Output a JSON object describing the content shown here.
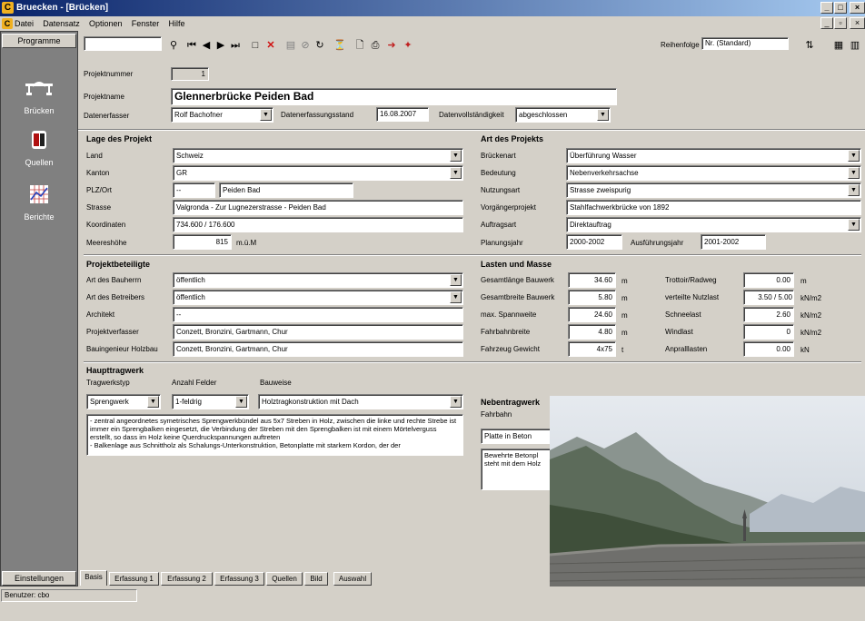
{
  "window": {
    "title": "Bruecken - [Brücken]",
    "app_letter": "C"
  },
  "menu": {
    "items": [
      "Datei",
      "Datensatz",
      "Optionen",
      "Fenster",
      "Hilfe"
    ]
  },
  "sidebar": {
    "header": "Programme",
    "items": [
      {
        "label": "Brücken",
        "icon": "bridge-icon"
      },
      {
        "label": "Quellen",
        "icon": "books-icon"
      },
      {
        "label": "Berichte",
        "icon": "report-chart-icon"
      }
    ],
    "footer": "Einstellungen"
  },
  "toolbar": {
    "search_value": "",
    "sort_label": "Reihenfolge",
    "sort_value": "Nr. (Standard)"
  },
  "project": {
    "number_label": "Projektnummer",
    "number": "1",
    "name_label": "Projektname",
    "name": "Glennerbrücke Peiden Bad",
    "author_label": "Datenerfasser",
    "author": "Rolf Bachofner",
    "date_label": "Datenerfassungsstand",
    "date": "16.08.2007",
    "completeness_label": "Datenvollständigkeit",
    "completeness": "abgeschlossen"
  },
  "lage": {
    "title": "Lage des Projekt",
    "land_label": "Land",
    "land": "Schweiz",
    "kanton_label": "Kanton",
    "kanton": "GR",
    "plz_label": "PLZ/Ort",
    "plz": "--",
    "ort": "Peiden Bad",
    "strasse_label": "Strasse",
    "strasse": "Valgronda - Zur Lugnezerstrasse - Peiden Bad",
    "koord_label": "Koordinaten",
    "koord": "734.600 / 176.600",
    "hoehe_label": "Meereshöhe",
    "hoehe": "815",
    "hoehe_unit": "m.ü.M"
  },
  "art": {
    "title": "Art des Projekts",
    "brueckenart_label": "Brückenart",
    "brueckenart": "Überführung Wasser",
    "bedeutung_label": "Bedeutung",
    "bedeutung": "Nebenverkehrsachse",
    "nutzung_label": "Nutzungsart",
    "nutzung": "Strasse zweispurig",
    "vorgaenger_label": "Vorgängerprojekt",
    "vorgaenger": "Stahlfachwerkbrücke von 1892",
    "auftrag_label": "Auftragsart",
    "auftrag": "Direktauftrag",
    "planung_label": "Planungsjahr",
    "planung": "2000-2002",
    "ausfuehrung_label": "Ausführungsjahr",
    "ausfuehrung": "2001-2002"
  },
  "beteiligte": {
    "title": "Projektbeteiligte",
    "bauherr_label": "Art des Bauherrn",
    "bauherr": "öffentlich",
    "betreiber_label": "Art des Betreibers",
    "betreiber": "öffentlich",
    "architekt_label": "Architekt",
    "architekt": "--",
    "verfasser_label": "Projektverfasser",
    "verfasser": "Conzett, Bronzini, Gartmann, Chur",
    "holzbau_label": "Bauingenieur Holzbau",
    "holzbau": "Conzett, Bronzini, Gartmann, Chur"
  },
  "lasten": {
    "title": "Lasten und Masse",
    "laenge_label": "Gesamtlänge Bauwerk",
    "laenge": "34.60",
    "laenge_unit": "m",
    "breite_label": "Gesamtbreite Bauwerk",
    "breite": "5.80",
    "breite_unit": "m",
    "spann_label": "max. Spannweite",
    "spann": "24.60",
    "spann_unit": "m",
    "fahrbahn_label": "Fahrbahnbreite",
    "fahrbahn": "4.80",
    "fahrbahn_unit": "m",
    "gewicht_label": "Fahrzeug Gewicht",
    "gewicht": "4x75",
    "gewicht_unit": "t",
    "trottoir_label": "Trottoir/Radweg",
    "trottoir": "0.00",
    "trottoir_unit": "m",
    "nutzlast_label": "verteilte Nutzlast",
    "nutzlast": "3.50 / 5.00",
    "nutzlast_unit": "kN/m2",
    "schnee_label": "Schneelast",
    "schnee": "2.60",
    "schnee_unit": "kN/m2",
    "wind_label": "Windlast",
    "wind": "0",
    "wind_unit": "kN/m2",
    "anprall_label": "Anpralllasten",
    "anprall": "0.00",
    "anprall_unit": "kN"
  },
  "haupt": {
    "title": "Haupttragwerk",
    "typ_label": "Tragwerkstyp",
    "typ": "Sprengwerk",
    "felder_label": "Anzahl Felder",
    "felder": "1-feldrig",
    "bauweise_label": "Bauweise",
    "bauweise": "Holztragkonstruktion mit Dach",
    "memo": "- zentral angeordnetes symetrisches Sprengwerkbündel aus 5x7 Streben in Holz, zwischen die linke und rechte Strebe ist immer ein Sprengbalken eingesetzt, die Verbindung der Streben mit den Sprengbalken ist mit einem Mörtelverguss erstellt, so dass im Holz keine Querdruckspannungen auftreten\n- Balkenlage aus Schnittholz als Schalungs-Unterkonstruktion, Betonplatte mit starkem Kordon, der der"
  },
  "neben": {
    "title": "Nebentragwerk",
    "fahrbahn_label": "Fahrbahn",
    "fahrbahn": "Platte in Beton",
    "memo": "Bewehrte Betonpl steht mit dem Holz"
  },
  "tabs": [
    "Basis",
    "Erfassung 1",
    "Erfassung 2",
    "Erfassung 3",
    "Quellen",
    "Bild",
    "Auswahl"
  ],
  "status": {
    "user": "Benutzer: cbo"
  }
}
